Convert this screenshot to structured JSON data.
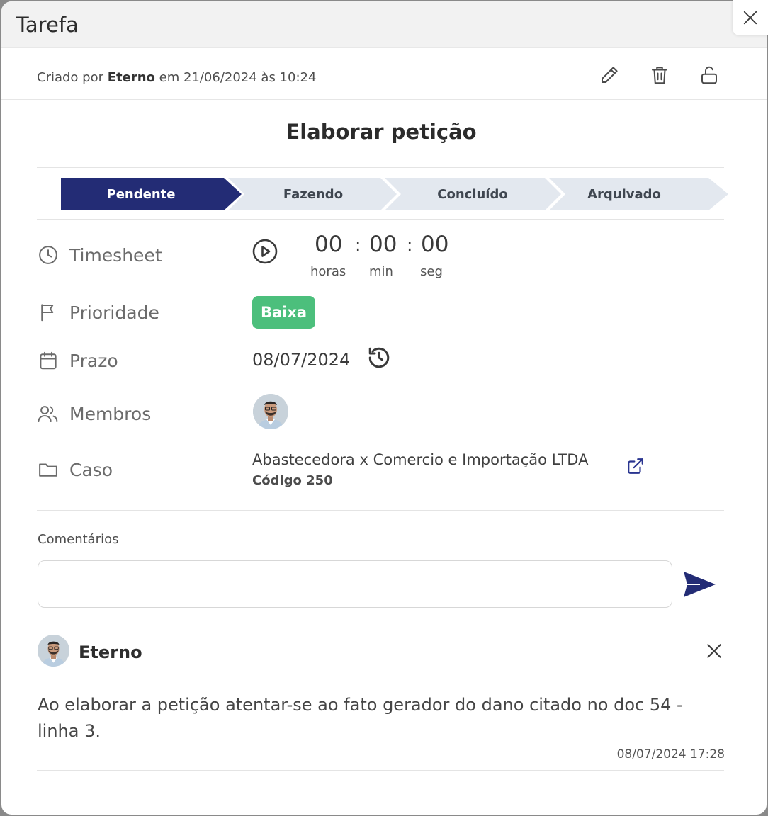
{
  "modal": {
    "title": "Tarefa"
  },
  "meta": {
    "created_prefix": "Criado por ",
    "created_by": "Eterno",
    "created_suffix": " em 21/06/2024 às 10:24",
    "actions": [
      {
        "name": "edit",
        "icon": "pencil-icon"
      },
      {
        "name": "delete",
        "icon": "trash-icon"
      },
      {
        "name": "unlock",
        "icon": "unlock-icon"
      }
    ]
  },
  "task": {
    "title": "Elaborar petição"
  },
  "steps": {
    "active_color": "#232c75",
    "inactive_color": "#e3e8ef",
    "items": [
      {
        "label": "Pendente",
        "active": true
      },
      {
        "label": "Fazendo",
        "active": false
      },
      {
        "label": "Concluído",
        "active": false
      },
      {
        "label": "Arquivado",
        "active": false
      }
    ]
  },
  "fields": {
    "timesheet": {
      "label": "Timesheet",
      "hours": "00",
      "minutes": "00",
      "seconds": "00",
      "hours_unit": "horas",
      "minutes_unit": "min",
      "seconds_unit": "seg",
      "separator": ":"
    },
    "priority": {
      "label": "Prioridade",
      "value": "Baixa",
      "color": "#4cbf7c"
    },
    "deadline": {
      "label": "Prazo",
      "value": "08/07/2024"
    },
    "members": {
      "label": "Membros"
    },
    "case": {
      "label": "Caso",
      "name": "Abastecedora x Comercio e Importação LTDA",
      "code": "Código 250"
    }
  },
  "comments": {
    "label": "Comentários",
    "input_value": "",
    "items": [
      {
        "author": "Eterno",
        "text": "Ao elaborar a petição atentar-se ao fato gerador do dano citado no doc 54 - linha 3.",
        "date": "08/07/2024 17:28"
      }
    ]
  },
  "colors": {
    "accent": "#232c75",
    "link": "#2a3590"
  }
}
